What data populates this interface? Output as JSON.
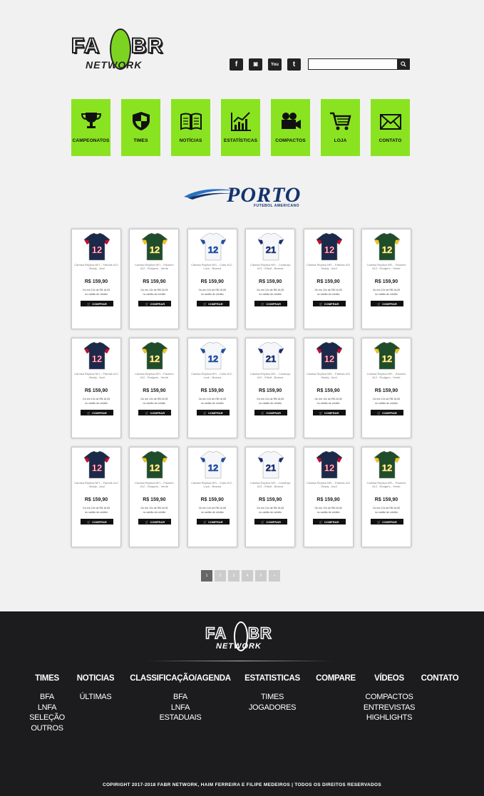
{
  "brand": {
    "logo_left": "FA",
    "logo_right": "BR",
    "logo_sub": "NETWORK"
  },
  "header": {
    "social": [
      {
        "icon": "facebook-icon",
        "glyph": "f"
      },
      {
        "icon": "instagram-icon",
        "glyph": "◙"
      },
      {
        "icon": "youtube-icon",
        "glyph": "You"
      },
      {
        "icon": "twitter-icon",
        "glyph": "t"
      }
    ],
    "search": {
      "placeholder": "",
      "value": ""
    }
  },
  "nav": [
    {
      "label": "CAMPEONATOS",
      "icon": "trophy-icon"
    },
    {
      "label": "TIMES",
      "icon": "shield-icon"
    },
    {
      "label": "NOTÍCIAS",
      "icon": "book-icon"
    },
    {
      "label": "ESTATÍSTICAS",
      "icon": "chart-icon"
    },
    {
      "label": "COMPACTOS",
      "icon": "camera-icon"
    },
    {
      "label": "LOJA",
      "icon": "cart-icon"
    },
    {
      "label": "CONTATO",
      "icon": "mail-icon"
    }
  ],
  "team": {
    "name": "PORTO",
    "subtitle": "FUTEBOL AMERICANO"
  },
  "products": [
    {
      "name": "Camisa Replica NFL - Patriots #12 - Brady - Azul",
      "price": "R$ 159,90",
      "installment": "Ou em 12x de R$ 16,05",
      "note": "no cartão de crédito",
      "buy": "COMPRAR",
      "number": "12",
      "color": "#1b2a4a",
      "accent": "#c60c30"
    },
    {
      "name": "Camisa Replica NFL - Packers #12 - Rodgers - Verde",
      "price": "R$ 159,90",
      "installment": "Ou em 12x de R$ 16,05",
      "note": "no cartão de crédito",
      "buy": "COMPRAR",
      "number": "12",
      "color": "#1f4d2b",
      "accent": "#f3c318"
    },
    {
      "name": "Camisa Replica NFL - Colts #12 - Luck - Branca",
      "price": "R$ 159,90",
      "installment": "Ou em 12x de R$ 16,05",
      "note": "no cartão de crédito",
      "buy": "COMPRAR",
      "number": "12",
      "color": "#f4f6fa",
      "accent": "#1f4fa0"
    },
    {
      "name": "Camisa Replica NFL - Cowboys #21 - Elliott - Branca",
      "price": "R$ 159,90",
      "installment": "Ou em 12x de R$ 16,05",
      "note": "no cartão de crédito",
      "buy": "COMPRAR",
      "number": "21",
      "color": "#f4f6fa",
      "accent": "#1c2f6e"
    },
    {
      "name": "Camisa Replica NFL - Patriots #12 - Brady - Azul",
      "price": "R$ 159,90",
      "installment": "Ou em 12x de R$ 16,05",
      "note": "no cartão de crédito",
      "buy": "COMPRAR",
      "number": "12",
      "color": "#1b2a4a",
      "accent": "#c60c30"
    },
    {
      "name": "Camisa Replica NFL - Packers #12 - Rodgers - Verde",
      "price": "R$ 159,90",
      "installment": "Ou em 12x de R$ 16,05",
      "note": "no cartão de crédito",
      "buy": "COMPRAR",
      "number": "12",
      "color": "#1f4d2b",
      "accent": "#f3c318"
    },
    {
      "name": "Camisa Replica NFL - Patriots #12 - Brady - Azul",
      "price": "R$ 159,90",
      "installment": "Ou em 12x de R$ 16,05",
      "note": "no cartão de crédito",
      "buy": "COMPRAR",
      "number": "12",
      "color": "#1b2a4a",
      "accent": "#c60c30"
    },
    {
      "name": "Camisa Replica NFL - Packers #12 - Rodgers - Verde",
      "price": "R$ 159,90",
      "installment": "Ou em 12x de R$ 16,05",
      "note": "no cartão de crédito",
      "buy": "COMPRAR",
      "number": "12",
      "color": "#1f4d2b",
      "accent": "#f3c318"
    },
    {
      "name": "Camisa Replica NFL - Colts #12 - Luck - Branca",
      "price": "R$ 159,90",
      "installment": "Ou em 12x de R$ 16,05",
      "note": "no cartão de crédito",
      "buy": "COMPRAR",
      "number": "12",
      "color": "#f4f6fa",
      "accent": "#1f4fa0"
    },
    {
      "name": "Camisa Replica NFL - Cowboys #21 - Elliott - Branca",
      "price": "R$ 159,90",
      "installment": "Ou em 12x de R$ 16,05",
      "note": "no cartão de crédito",
      "buy": "COMPRAR",
      "number": "21",
      "color": "#f4f6fa",
      "accent": "#1c2f6e"
    },
    {
      "name": "Camisa Replica NFL - Patriots #12 - Brady - Azul",
      "price": "R$ 159,90",
      "installment": "Ou em 12x de R$ 16,05",
      "note": "no cartão de crédito",
      "buy": "COMPRAR",
      "number": "12",
      "color": "#1b2a4a",
      "accent": "#c60c30"
    },
    {
      "name": "Camisa Replica NFL - Packers #12 - Rodgers - Verde",
      "price": "R$ 159,90",
      "installment": "Ou em 12x de R$ 16,05",
      "note": "no cartão de crédito",
      "buy": "COMPRAR",
      "number": "12",
      "color": "#1f4d2b",
      "accent": "#f3c318"
    },
    {
      "name": "Camisa Replica NFL - Patriots #12 - Brady - Azul",
      "price": "R$ 159,90",
      "installment": "Ou em 12x de R$ 16,05",
      "note": "no cartão de crédito",
      "buy": "COMPRAR",
      "number": "12",
      "color": "#1b2a4a",
      "accent": "#c60c30"
    },
    {
      "name": "Camisa Replica NFL - Packers #12 - Rodgers - Verde",
      "price": "R$ 159,90",
      "installment": "Ou em 12x de R$ 16,05",
      "note": "no cartão de crédito",
      "buy": "COMPRAR",
      "number": "12",
      "color": "#1f4d2b",
      "accent": "#f3c318"
    },
    {
      "name": "Camisa Replica NFL - Colts #12 - Luck - Branca",
      "price": "R$ 159,90",
      "installment": "Ou em 12x de R$ 16,05",
      "note": "no cartão de crédito",
      "buy": "COMPRAR",
      "number": "12",
      "color": "#f4f6fa",
      "accent": "#1f4fa0"
    },
    {
      "name": "Camisa Replica NFL - Cowboys #21 - Elliott - Branca",
      "price": "R$ 159,90",
      "installment": "Ou em 12x de R$ 16,05",
      "note": "no cartão de crédito",
      "buy": "COMPRAR",
      "number": "21",
      "color": "#f4f6fa",
      "accent": "#1c2f6e"
    },
    {
      "name": "Camisa Replica NFL - Patriots #12 - Brady - Azul",
      "price": "R$ 159,90",
      "installment": "Ou em 12x de R$ 16,05",
      "note": "no cartão de crédito",
      "buy": "COMPRAR",
      "number": "12",
      "color": "#1b2a4a",
      "accent": "#c60c30"
    },
    {
      "name": "Camisa Replica NFL - Packers #12 - Rodgers - Verde",
      "price": "R$ 159,90",
      "installment": "Ou em 12x de R$ 16,05",
      "note": "no cartão de crédito",
      "buy": "COMPRAR",
      "number": "12",
      "color": "#1f4d2b",
      "accent": "#f3c318"
    }
  ],
  "pagination": {
    "pages": [
      "1",
      "2",
      "3",
      "4",
      "5",
      "»"
    ],
    "active": "1"
  },
  "footer": {
    "columns": [
      {
        "heading": "TIMES",
        "items": [
          "BFA",
          "LNFA",
          "SELEÇÃO",
          "OUTROS"
        ]
      },
      {
        "heading": "NOTICIAS",
        "items": [
          "ÚLTIMAS"
        ]
      },
      {
        "heading": "CLASSIFICAÇÃO/AGENDA",
        "items": [
          "BFA",
          "LNFA",
          "ESTADUAIS"
        ]
      },
      {
        "heading": "ESTATISTICAS",
        "items": [
          "TIMES",
          "JOGADORES"
        ]
      },
      {
        "heading": "COMPARE",
        "items": []
      },
      {
        "heading": "VÍDEOS",
        "items": [
          "COMPACTOS",
          "ENTREVISTAS",
          "HIGHLIGHTS"
        ]
      },
      {
        "heading": "CONTATO",
        "items": []
      }
    ],
    "copyright": "COPIRIGHT 2017-2018 FABR NETWORK, HAIM FERREIRA E FILIPE MEDEIROS  |  TODOS OS DIREITOS RESERVADOS"
  },
  "colors": {
    "accent_green": "#8ae321",
    "footer_bg": "#1c1c1e",
    "page_bg": "#f1f1f1"
  }
}
